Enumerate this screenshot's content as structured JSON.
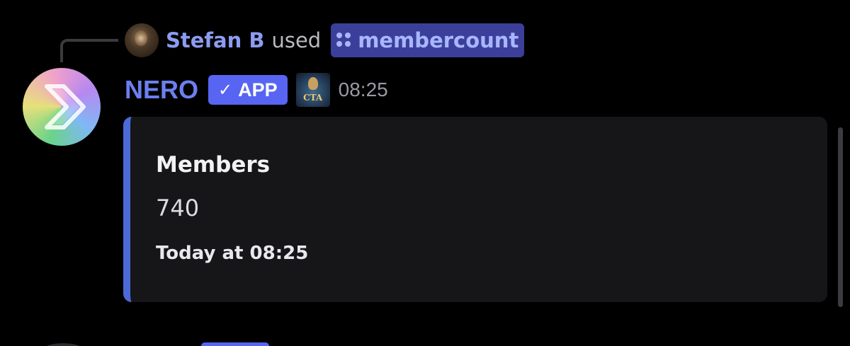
{
  "reply": {
    "username": "Stefan B",
    "used_text": "used",
    "command_name": "membercount"
  },
  "message": {
    "bot_name": "NERO",
    "app_badge": "APP",
    "app_badge_check": "✓",
    "role_icon_text": "CTA",
    "timestamp": "08:25"
  },
  "embed": {
    "accent_color": "#4d6bd8",
    "field_name": "Members",
    "field_value": "740",
    "footer": "Today at 08:25"
  },
  "colors": {
    "background": "#000000",
    "username": "#8c9cf0",
    "bot_name": "#6c7ff0",
    "app_badge": "#5865f2",
    "command_chip": "#3b3f9a"
  },
  "icons": {
    "command": "command-grid-icon",
    "bot_avatar": "chevron-arrow-icon",
    "role": "cta-role-icon"
  }
}
